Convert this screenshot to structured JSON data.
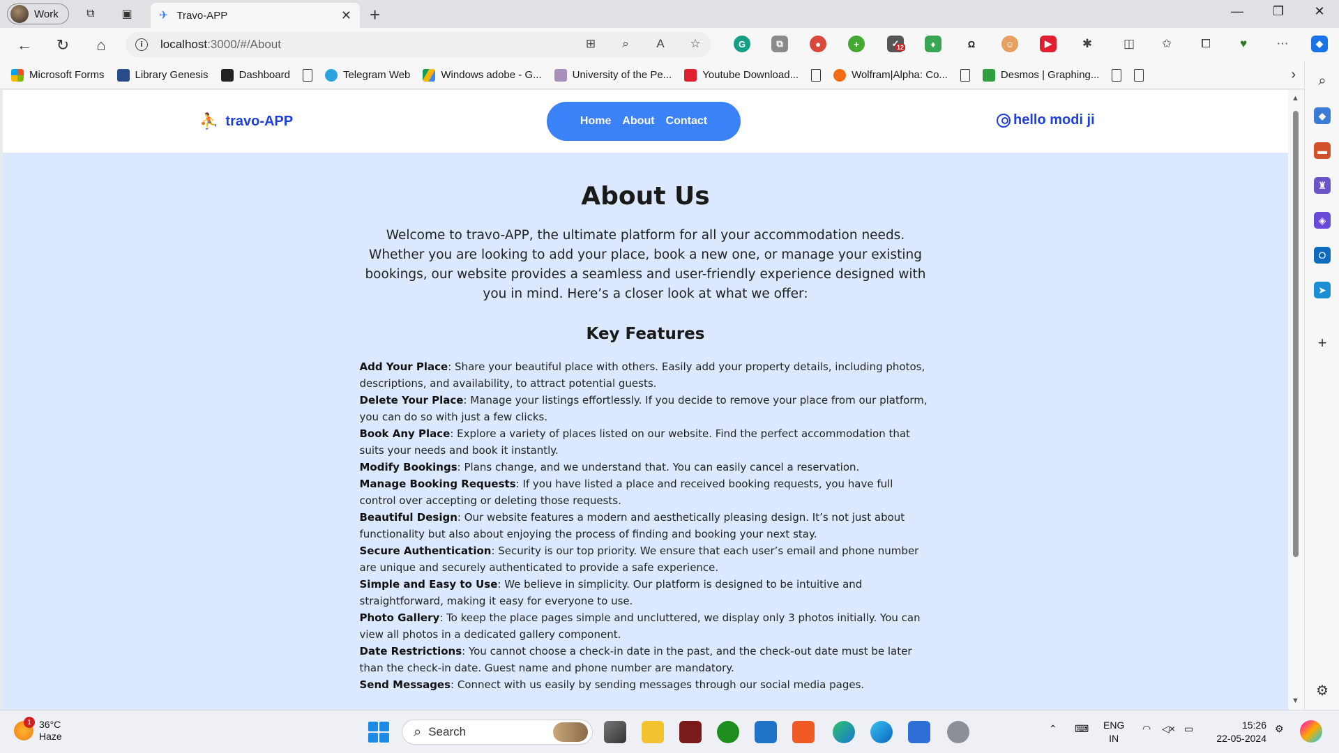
{
  "browser": {
    "profile_label": "Work",
    "tab_title": "Travo-APP",
    "address_host": "localhost",
    "address_path": ":3000/#/About",
    "extension_badge": "12",
    "bookmarks": [
      {
        "label": "Microsoft Forms",
        "icon": "microsoft-icon"
      },
      {
        "label": "Library Genesis",
        "icon": "libgen-icon"
      },
      {
        "label": "Dashboard",
        "icon": "dashboard-icon"
      },
      {
        "label": "",
        "icon": "document-icon"
      },
      {
        "label": "Telegram Web",
        "icon": "telegram-icon"
      },
      {
        "label": "Windows adobe - G...",
        "icon": "google-drive-icon"
      },
      {
        "label": "University of the Pe...",
        "icon": "university-icon"
      },
      {
        "label": "Youtube Download...",
        "icon": "youtube-download-icon"
      },
      {
        "label": "",
        "icon": "document-icon"
      },
      {
        "label": "Wolfram|Alpha: Co...",
        "icon": "wolfram-icon"
      },
      {
        "label": "",
        "icon": "document-icon"
      },
      {
        "label": "Desmos | Graphing...",
        "icon": "desmos-icon"
      },
      {
        "label": "",
        "icon": "document-icon"
      },
      {
        "label": "",
        "icon": "document-icon"
      }
    ]
  },
  "site": {
    "logo_text": "travo-APP",
    "nav": {
      "home": "Home",
      "about": "About",
      "contact": "Contact"
    },
    "user_text": "hello modi ji",
    "accent": "#3b82f6",
    "brand_color": "#1d3fe0",
    "page_bg": "#dbe8fd"
  },
  "about": {
    "title": "About Us",
    "intro": "Welcome to travo-APP, the ultimate platform for all your accommodation needs. Whether you are looking to add your place, book a new one, or manage your existing bookings, our website provides a seamless and user-friendly experience designed with you in mind. Here’s a closer look at what we offer:",
    "features_heading": "Key Features",
    "features": [
      {
        "name": "Add Your Place",
        "text": ": Share your beautiful place with others. Easily add your property details, including photos, descriptions, and availability, to attract potential guests."
      },
      {
        "name": "Delete Your Place",
        "text": ": Manage your listings effortlessly. If you decide to remove your place from our platform, you can do so with just a few clicks."
      },
      {
        "name": "Book Any Place",
        "text": ": Explore a variety of places listed on our website. Find the perfect accommodation that suits your needs and book it instantly."
      },
      {
        "name": "Modify Bookings",
        "text": ": Plans change, and we understand that. You can easily cancel a reservation."
      },
      {
        "name": "Manage Booking Requests",
        "text": ": If you have listed a place and received booking requests, you have full control over accepting or deleting those requests."
      },
      {
        "name": "Beautiful Design",
        "text": ": Our website features a modern and aesthetically pleasing design. It’s not just about functionality but also about enjoying the process of finding and booking your next stay."
      },
      {
        "name": "Secure Authentication",
        "text": ": Security is our top priority. We ensure that each user’s email and phone number are unique and securely authenticated to provide a safe experience."
      },
      {
        "name": "Simple and Easy to Use",
        "text": ": We believe in simplicity. Our platform is designed to be intuitive and straightforward, making it easy for everyone to use."
      },
      {
        "name": "Photo Gallery",
        "text": ": To keep the place pages simple and uncluttered, we display only 3 photos initially. You can view all photos in a dedicated gallery component."
      },
      {
        "name": "Date Restrictions",
        "text": ": You cannot choose a check-in date in the past, and the check-out date must be later than the check-in date. Guest name and phone number are mandatory."
      },
      {
        "name": "Send Messages",
        "text": ": Connect with us easily by sending messages through our social media pages."
      }
    ]
  },
  "taskbar": {
    "weather_temp": "36°C",
    "weather_desc": "Haze",
    "weather_badge": "1",
    "search_label": "Search",
    "lang_line1": "ENG",
    "lang_line2": "IN",
    "time": "15:26",
    "date": "22-05-2024"
  }
}
